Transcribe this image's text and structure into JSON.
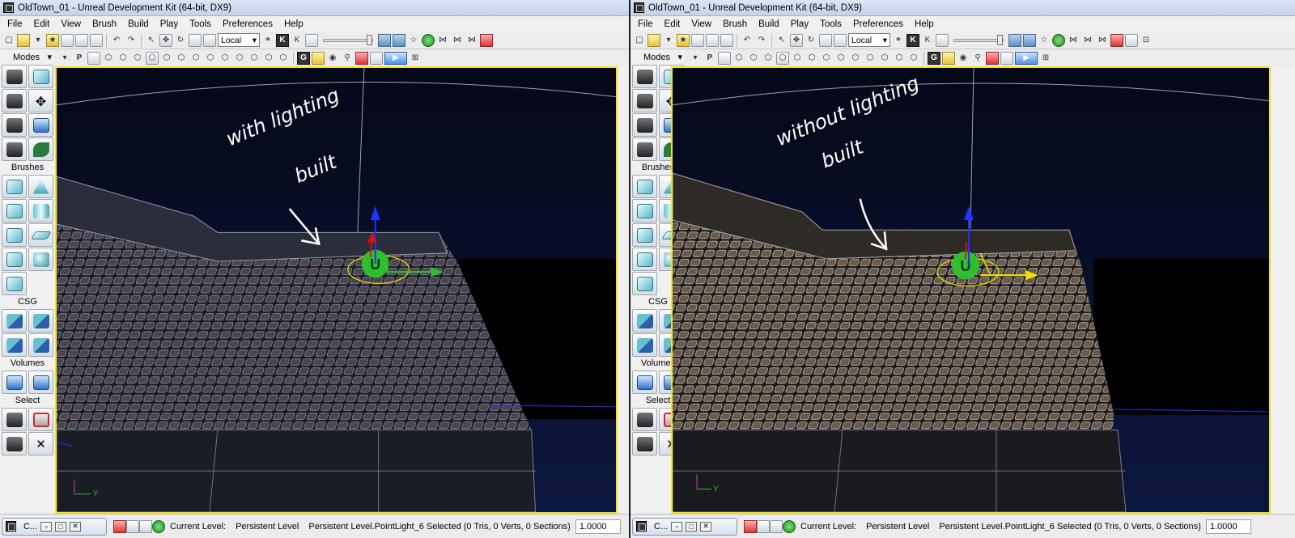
{
  "panels": [
    {
      "id": "left",
      "window_title": "OldTown_01 - Unreal Development Kit (64-bit, DX9)",
      "menu": [
        "File",
        "Edit",
        "View",
        "Brush",
        "Build",
        "Play",
        "Tools",
        "Preferences",
        "Help"
      ],
      "coord_dropdown": "Local",
      "sidebar": {
        "modes_label": "Modes",
        "brushes_label": "Brushes",
        "csg_label": "CSG",
        "volumes_label": "Volumes",
        "select_label": "Select"
      },
      "annotation": [
        "with lighting",
        "built"
      ],
      "axis_y": "Y",
      "status": {
        "task_label": "C...",
        "current_level_label": "Current Level:",
        "current_level_value": "Persistent Level",
        "selection": "Persistent Level.PointLight_6 Selected (0 Tris, 0 Verts, 0 Sections)",
        "zoom": "1.0000"
      }
    },
    {
      "id": "right",
      "window_title": "OldTown_01 - Unreal Development Kit (64-bit, DX9)",
      "menu": [
        "File",
        "Edit",
        "View",
        "Brush",
        "Build",
        "Play",
        "Tools",
        "Preferences",
        "Help"
      ],
      "coord_dropdown": "Local",
      "sidebar": {
        "modes_label": "Modes",
        "brushes_label": "Brushes",
        "csg_label": "CSG",
        "volumes_label": "Volumes",
        "select_label": "Select"
      },
      "annotation": [
        "without lighting",
        "built"
      ],
      "axis_y": "Y",
      "status": {
        "task_label": "C...",
        "current_level_label": "Current Level:",
        "current_level_value": "Persistent Level",
        "selection": "Persistent Level.PointLight_6 Selected (0 Tris, 0 Verts, 0 Sections)",
        "zoom": "1.0000"
      }
    }
  ],
  "colors": {
    "viewport_border": "#f5e21c",
    "viewport_bg": "#050915",
    "gizmo_green": "#2fbf2f",
    "gizmo_yellow": "#f0e000",
    "gizmo_blue": "#2233ff",
    "gizmo_red": "#e01010"
  }
}
